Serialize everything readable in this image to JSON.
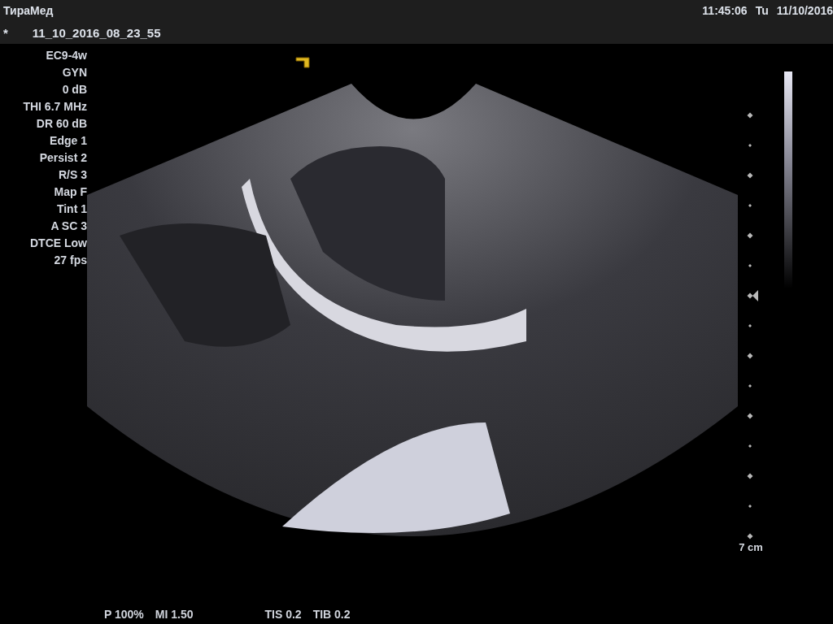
{
  "header": {
    "app_name": "ТираМед",
    "time": "11:45:06",
    "day": "Tu",
    "date": "11/10/2016",
    "file_marker": "*",
    "file_name": "11_10_2016_08_23_55"
  },
  "parameters": [
    "EC9-4w",
    "GYN",
    "0 dB",
    "THI 6.7 MHz",
    "DR 60 dB",
    "Edge 1",
    "Persist 2",
    "R/S 3",
    "Map F",
    "Tint 1",
    "A SC 3",
    "DTCE Low",
    "27 fps"
  ],
  "depth_scale": {
    "label": "7 cm"
  },
  "footer": [
    "P 100%",
    "MI 1.50",
    "TIS 0.2",
    "TIB 0.2"
  ]
}
